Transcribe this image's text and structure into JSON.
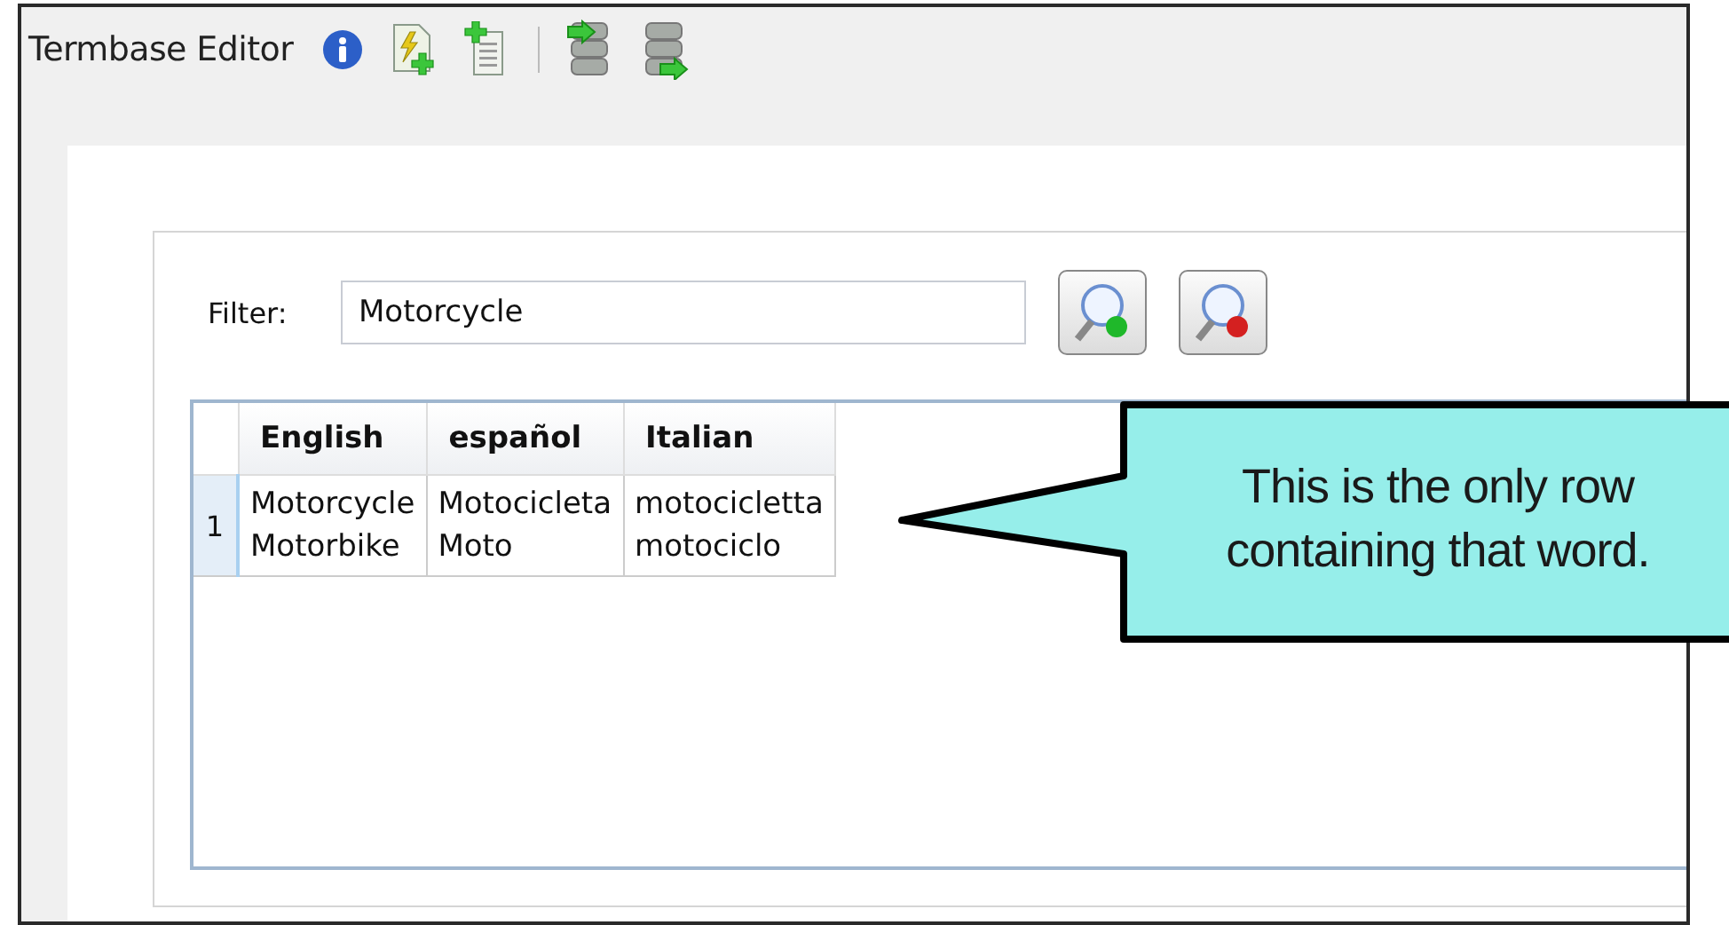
{
  "window": {
    "title": "Termbase Editor"
  },
  "filter": {
    "label": "Filter:",
    "value": "Motorcycle"
  },
  "table": {
    "columns": [
      "English",
      "español",
      "Italian"
    ],
    "rows": [
      {
        "number": "1",
        "cells": [
          [
            "Motorcycle",
            "Motorbike"
          ],
          [
            "Motocicleta",
            "Moto"
          ],
          [
            "motocicletta",
            "motociclo"
          ]
        ]
      }
    ]
  },
  "callout": {
    "text": "This is the only row containing that word."
  }
}
